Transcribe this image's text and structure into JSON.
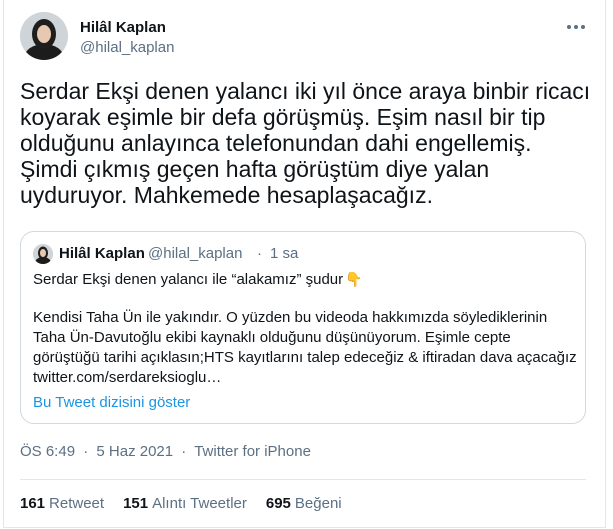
{
  "author": {
    "name": "Hilâl Kaplan",
    "handle": "@hilal_kaplan"
  },
  "tweet": {
    "text": "Serdar Ekşi denen yalancı iki yıl önce araya binbir ricacı\nkoyarak eşimle bir defa görüşmüş. Eşim nasıl bir tip\nolduğunu anlayınca telefonundan dahi engellemiş.\nŞimdi çıkmış geçen hafta görüştüm diye yalan\nuyduruyor. Mahkemede hesaplaşacağız."
  },
  "quote": {
    "name": "Hilâl Kaplan",
    "handle": "@hilal_kaplan",
    "separator": "·",
    "time": "1 sa",
    "first_line": "Serdar Ekşi denen yalancı ile “alakamız” şudur",
    "first_line_emoji": "👇",
    "body": "Kendisi Taha Ün ile yakındır. O yüzden bu videoda hakkımızda söylediklerinin\nTaha Ün-Davutoğlu ekibi kaynaklı olduğunu düşünüyorum. Eşimle cepte\ngörüştüğü tarihi açıklasın;HTS kayıtlarını talep edeceğiz & iftiradan dava açacağız\ntwitter.com/serdareksioglu…",
    "show_thread": "Bu Tweet dizisini göster"
  },
  "meta": {
    "time": "ÖS 6:49",
    "sep1": "·",
    "date": "5 Haz 2021",
    "sep2": "·",
    "client": "Twitter for iPhone"
  },
  "stats": {
    "retweets_count": "161",
    "retweets_label": "Retweet",
    "quotes_count": "151",
    "quotes_label": "Alıntı Tweetler",
    "likes_count": "695",
    "likes_label": "Beğeni"
  },
  "icons": {
    "more": "more-horizontal-icon"
  },
  "colors": {
    "link": "#1b95e0",
    "secondary_text": "#5b7083",
    "border": "#cfd9de"
  }
}
